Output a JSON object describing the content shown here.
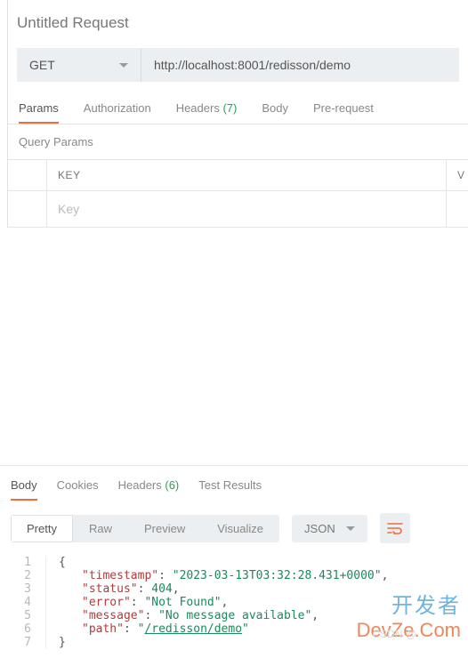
{
  "header": {
    "title": "Untitled Request"
  },
  "request": {
    "method": "GET",
    "url": "http://localhost:8001/redisson/demo"
  },
  "tabs": {
    "params": "Params",
    "authorization": "Authorization",
    "headers_label": "Headers",
    "headers_count": "(7)",
    "body": "Body",
    "prerequest": "Pre-request"
  },
  "query": {
    "title": "Query Params",
    "key_header": "KEY",
    "value_header": "V",
    "key_placeholder": "Key"
  },
  "response_tabs": {
    "body": "Body",
    "cookies": "Cookies",
    "headers_label": "Headers",
    "headers_count": "(6)",
    "test": "Test Results"
  },
  "view_modes": {
    "pretty": "Pretty",
    "raw": "Raw",
    "preview": "Preview",
    "visualize": "Visualize",
    "format": "JSON"
  },
  "json_body": {
    "open": "{",
    "close": "}",
    "lines": [
      {
        "n": "1"
      },
      {
        "n": "2",
        "key": "\"timestamp\"",
        "val": "\"2023-03-13T03:32:28.431+0000\"",
        "comma": ","
      },
      {
        "n": "3",
        "key": "\"status\"",
        "val_num": "404",
        "comma": ","
      },
      {
        "n": "4",
        "key": "\"error\"",
        "val": "\"Not Found\"",
        "comma": ","
      },
      {
        "n": "5",
        "key": "\"message\"",
        "val": "\"No message available\"",
        "comma": ","
      },
      {
        "n": "6",
        "key": "\"path\"",
        "val_link": "/redisson/demo"
      },
      {
        "n": "7"
      }
    ]
  },
  "watermark": {
    "cn": "开发者",
    "en": "DevZe.Com",
    "csdn": "CSDN @"
  }
}
